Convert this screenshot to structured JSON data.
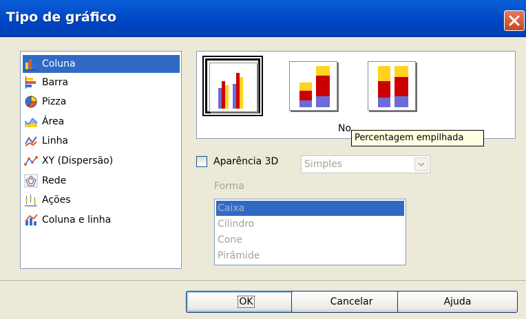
{
  "window": {
    "title": "Tipo de gráfico"
  },
  "categories": [
    {
      "label": "Coluna",
      "icon": "column-chart-icon",
      "selected": true
    },
    {
      "label": "Barra",
      "icon": "bar-chart-icon"
    },
    {
      "label": "Pizza",
      "icon": "pie-chart-icon"
    },
    {
      "label": "Área",
      "icon": "area-chart-icon"
    },
    {
      "label": "Linha",
      "icon": "line-chart-icon"
    },
    {
      "label": "XY (Dispersão)",
      "icon": "scatter-chart-icon"
    },
    {
      "label": "Rede",
      "icon": "net-chart-icon"
    },
    {
      "label": "Ações",
      "icon": "stock-chart-icon"
    },
    {
      "label": "Coluna e linha",
      "icon": "column-line-chart-icon"
    }
  ],
  "variants": {
    "label": "No",
    "tooltip": "Percentagem empilhada"
  },
  "appearance": {
    "label": "Aparência 3D",
    "checked": false,
    "combo_value": "Simples"
  },
  "shape": {
    "label": "Forma",
    "items": [
      "Caixa",
      "Cilindro",
      "Cone",
      "Pirâmide"
    ]
  },
  "buttons": {
    "ok": "OK",
    "cancel": "Cancelar",
    "help": "Ajuda"
  },
  "colors": {
    "title_bar": "#0054e3",
    "selection": "#316ac5",
    "bar_red": "#cc0000",
    "bar_yellow": "#ffd320",
    "bar_blue": "#6c6cd8"
  }
}
